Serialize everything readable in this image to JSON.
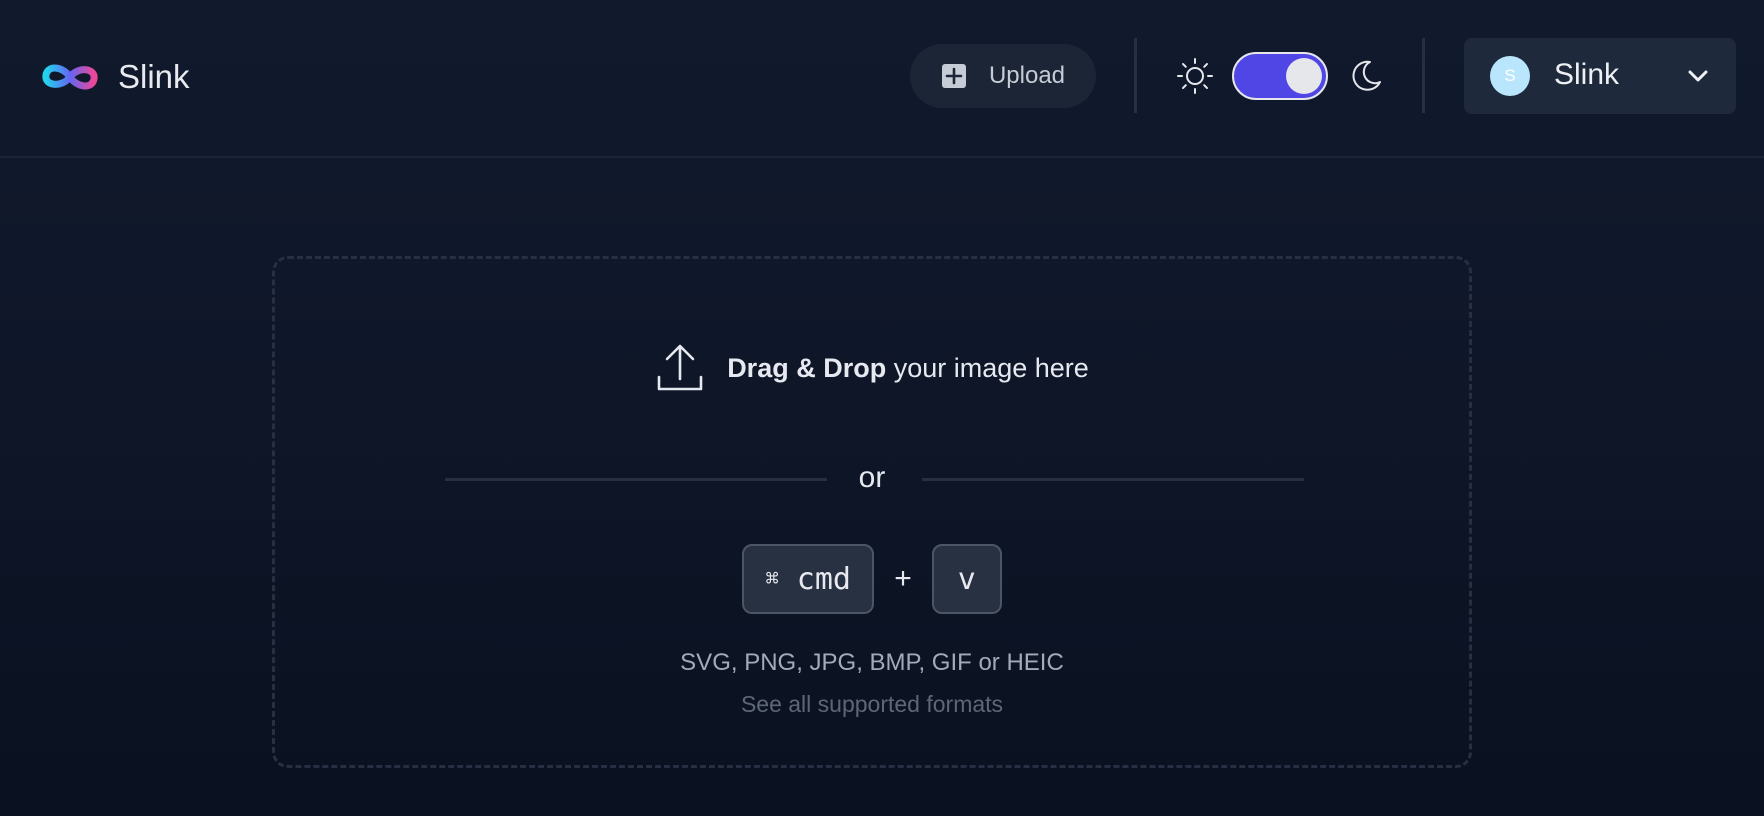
{
  "header": {
    "app_name": "Slink",
    "upload_label": "Upload",
    "theme_toggle_on": true,
    "account": {
      "avatar_initial": "S",
      "name": "Slink"
    }
  },
  "dropzone": {
    "drag_bold": "Drag & Drop",
    "drag_rest": " your image here",
    "or_text": "or",
    "shortcut": {
      "modifier_glyph": "⌘",
      "modifier_label": "cmd",
      "plus": "+",
      "key": "v"
    },
    "formats_text": "SVG, PNG, JPG, BMP, GIF or HEIC",
    "see_all_link": "See all supported formats"
  },
  "colors": {
    "background": "#0e1628",
    "toggle_accent": "#4f46e5",
    "avatar_bg": "#bae6fd",
    "logo_gradient": [
      "#22d3ee",
      "#a855f7",
      "#ec4899"
    ]
  },
  "icons": [
    "infinity-logo-icon",
    "plus-square-icon",
    "sun-icon",
    "moon-icon",
    "chevron-down-icon",
    "upload-icon"
  ]
}
